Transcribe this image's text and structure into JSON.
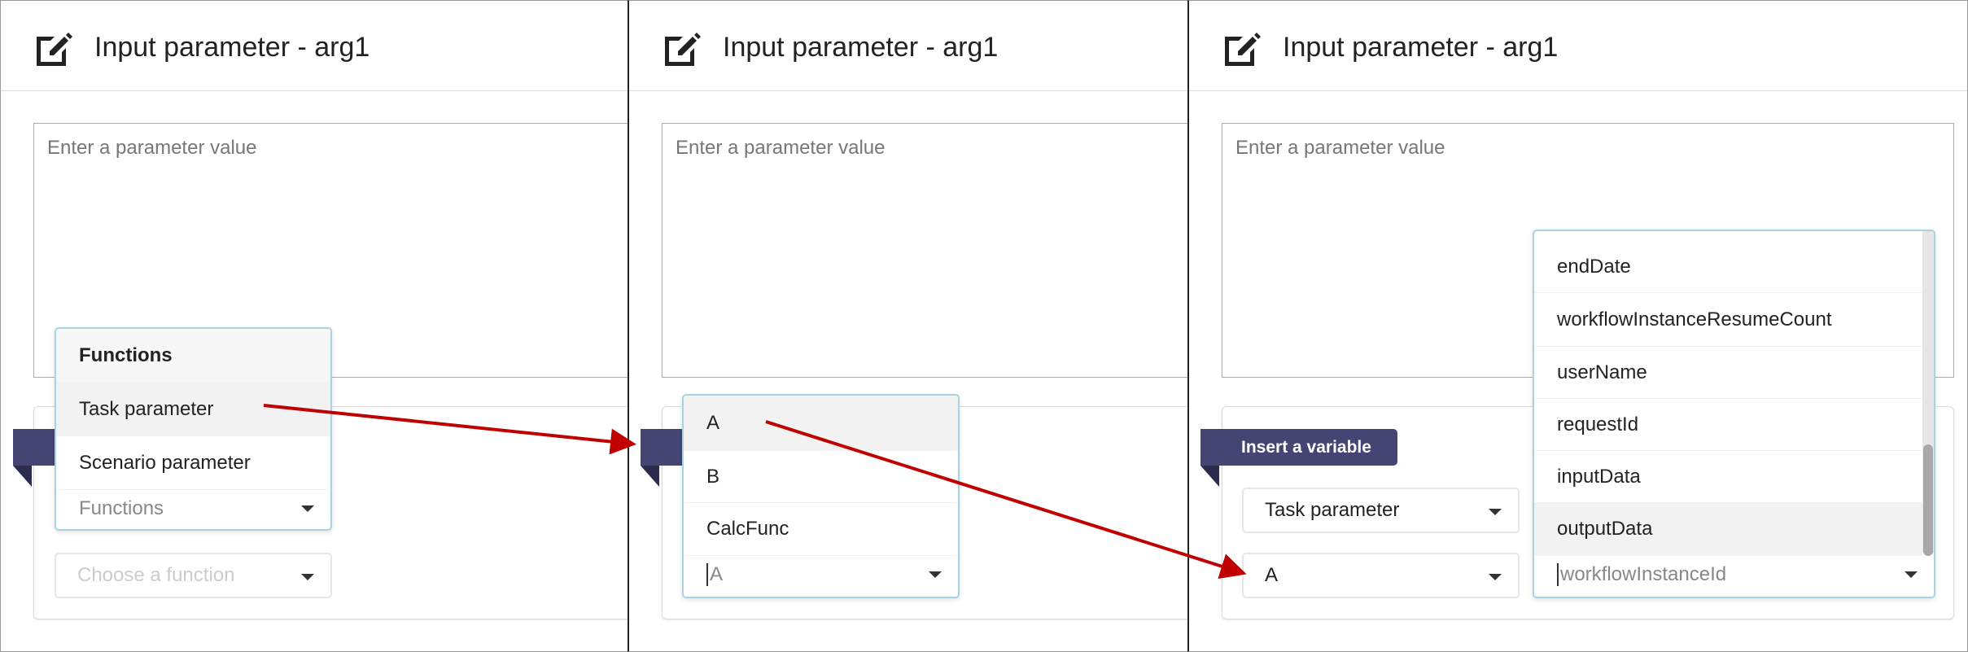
{
  "panels": [
    {
      "title": "Input parameter - arg1",
      "placeholder": "Enter a parameter value",
      "dropdown": {
        "header": "Functions",
        "items": [
          "Task parameter",
          "Scenario parameter"
        ],
        "highlighted": "Task parameter",
        "input_placeholder": "Functions"
      },
      "function_select": {
        "placeholder": "Choose a function"
      }
    },
    {
      "title": "Input parameter - arg1",
      "placeholder": "Enter a parameter value",
      "dropdown": {
        "items": [
          "A",
          "B",
          "CalcFunc"
        ],
        "highlighted": "A",
        "input_placeholder": "A"
      }
    },
    {
      "title": "Input parameter - arg1",
      "placeholder": "Enter a parameter value",
      "ribbon_label": "Insert a variable",
      "type_select": {
        "value": "Task parameter"
      },
      "task_select": {
        "value": "A"
      },
      "dropdown": {
        "items": [
          "endDate",
          "workflowInstanceResumeCount",
          "userName",
          "requestId",
          "inputData",
          "outputData"
        ],
        "highlighted": "outputData",
        "input_placeholder": "workflowInstanceId"
      }
    }
  ],
  "colors": {
    "ribbon": "#454573",
    "arrow": "#c00000",
    "dropdown_border": "#a9d3e3",
    "highlight": "#f2f2f2"
  },
  "icons": {
    "header": "edit-icon",
    "select": "caret-down-icon"
  }
}
